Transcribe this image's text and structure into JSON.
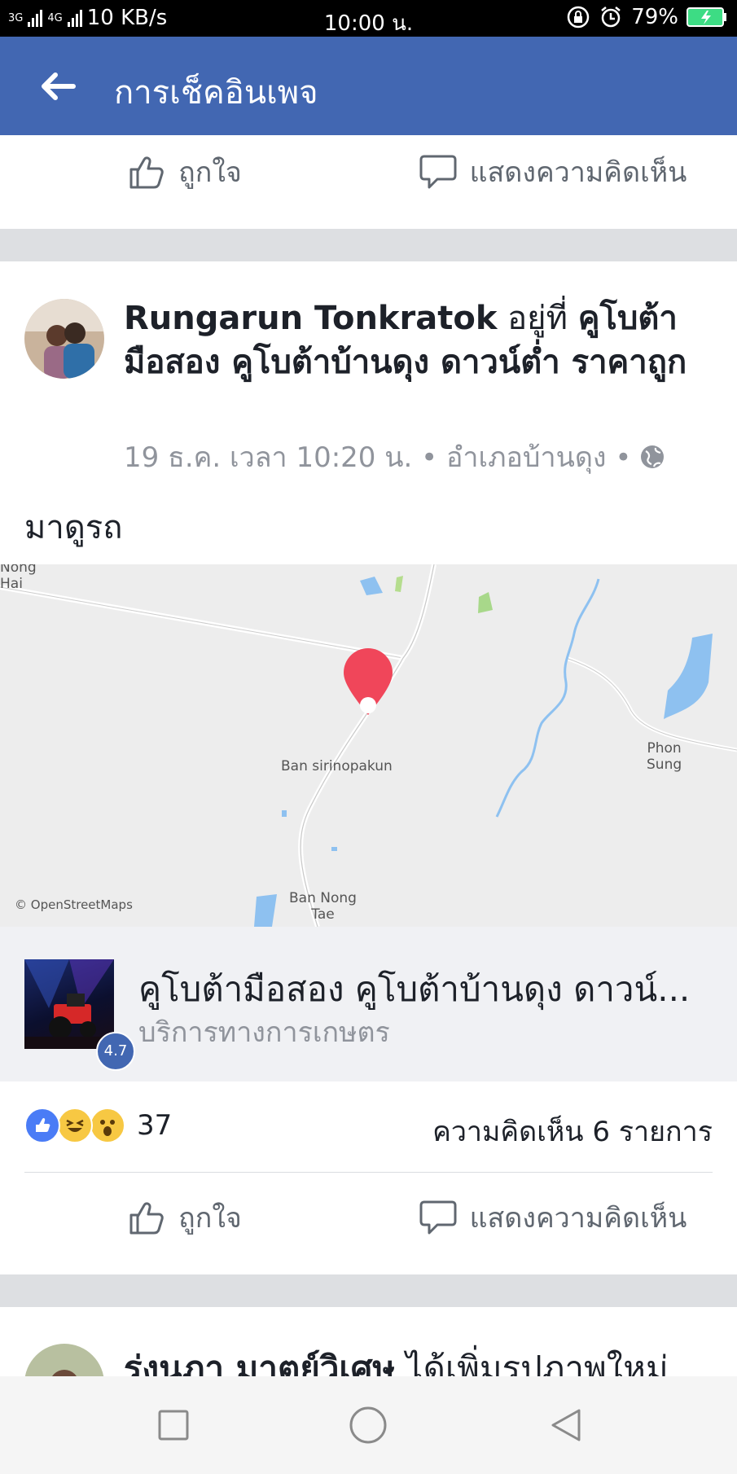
{
  "status_bar": {
    "net_3g": "3G",
    "net_4g": "4G",
    "speed": "10 KB/s",
    "time": "10:00 น.",
    "battery": "79%"
  },
  "app_bar": {
    "title": "การเช็คอินเพจ"
  },
  "top_actions": {
    "like": "ถูกใจ",
    "comment": "แสดงความคิดเห็น"
  },
  "post": {
    "author": "Rungarun Tonkratok",
    "at_word": " อยู่ที่ ",
    "place": "คูโบต้ามือสอง คูโบต้าบ้านดุง ดาวน์ต่ำ ราคาถูก",
    "meta": "19 ธ.ค. เวลา 10:20 น. • อำเภอบ้านดุง •",
    "text": "มาดูรถ"
  },
  "map": {
    "labels": {
      "nong_hai_1": "Nong",
      "nong_hai_2": "Hai",
      "ban_sirinopakun": "Ban sirinopakun",
      "phon_sung_1": "Phon",
      "phon_sung_2": "Sung",
      "ban_nong_tae_1": "Ban Nong",
      "ban_nong_tae_2": "Tae",
      "attribution": "© OpenStreetMaps"
    }
  },
  "place_card": {
    "name": "คูโบต้ามือสอง คูโบต้าบ้านดุง ดาวน์...",
    "category": "บริการทางการเกษตร",
    "rating": "4.7"
  },
  "reactions": {
    "count": "37",
    "comments": "ความคิดเห็น 6 รายการ"
  },
  "bottom_actions": {
    "like": "ถูกใจ",
    "comment": "แสดงความคิดเห็น"
  },
  "next_post": {
    "author": "รุ่งนภา มาตย์วิเศษ",
    "action": " ได้เพิ่มรูปภาพใหม่"
  },
  "colors": {
    "brand": "#4267b2",
    "pin": "#f0465a",
    "water": "#8ec1f0"
  }
}
